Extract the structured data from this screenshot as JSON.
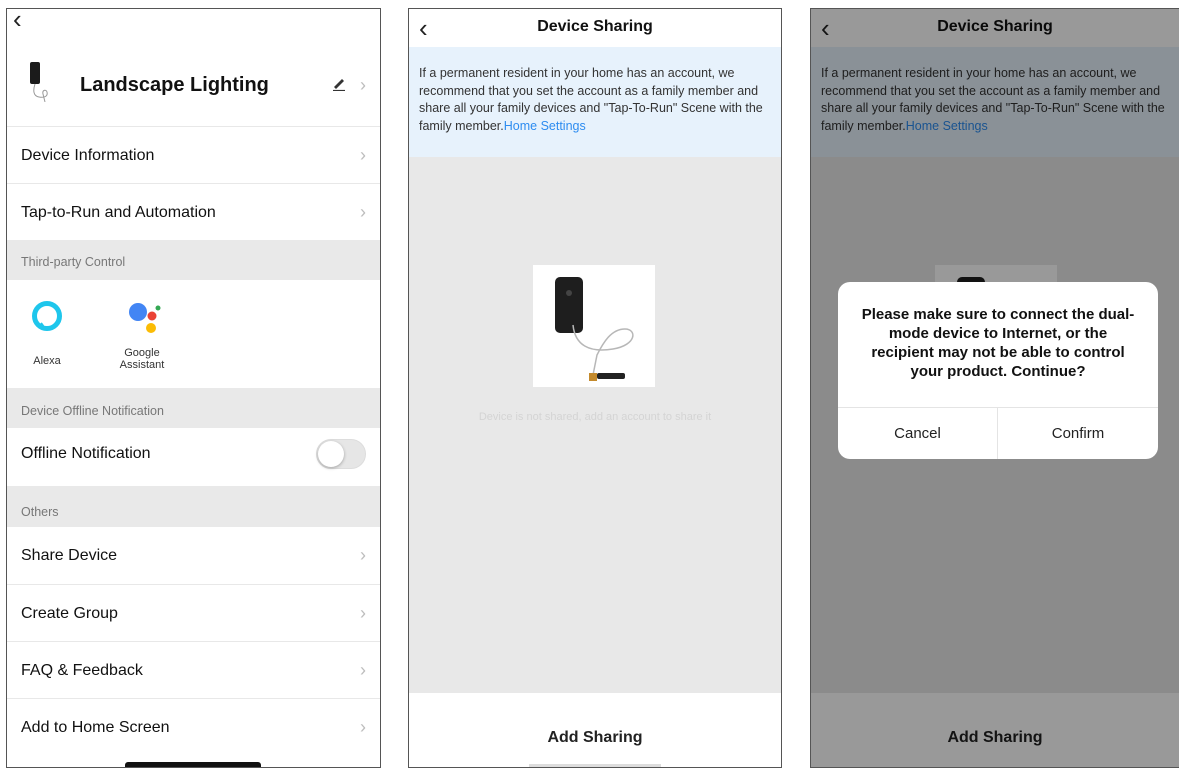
{
  "screen1": {
    "device_name": "Landscape Lighting",
    "items": {
      "device_information": "Device Information",
      "tap_to_run": "Tap-to-Run and Automation"
    },
    "sections": {
      "third_party": "Third-party Control",
      "offline": "Device Offline Notification",
      "others": "Others"
    },
    "third_party": {
      "alexa": "Alexa",
      "google_line1": "Google",
      "google_line2": "Assistant"
    },
    "offline_notification": "Offline Notification",
    "offline_enabled": false,
    "others": {
      "share_device": "Share Device",
      "create_group": "Create Group",
      "faq": "FAQ & Feedback",
      "add_home": "Add to Home Screen"
    }
  },
  "sharing": {
    "title": "Device Sharing",
    "notice_text": "If a permanent resident in your home has an account, we recommend that you set the account as a family member and share all your family devices and \"Tap-To-Run\" Scene with the family member.",
    "notice_link": "Home Settings",
    "empty_text": "Device is not shared, add an account to share it",
    "add_button": "Add Sharing"
  },
  "dialog": {
    "message": "Please make sure to connect the dual-mode device to Internet,  or the recipient may not be able to control your product. Continue?",
    "cancel": "Cancel",
    "confirm": "Confirm"
  },
  "colors": {
    "link": "#2d8cf0",
    "notice_bg": "#e7f2fc",
    "alexa": "#1ec6ec"
  },
  "icons": {
    "back": "chevron-left-icon",
    "chevron": "chevron-right-icon",
    "edit": "pencil-icon"
  }
}
